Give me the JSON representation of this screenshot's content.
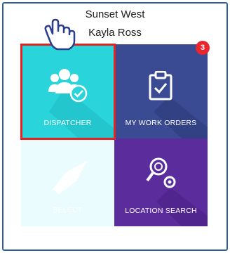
{
  "header": {
    "site_name": "Sunset West",
    "user_name": "Kayla Ross"
  },
  "tiles": [
    {
      "label": "DISPATCHER",
      "icon": "users-check-icon",
      "color": "#29d4db",
      "selected": true
    },
    {
      "label": "MY WORK ORDERS",
      "icon": "clipboard-check-icon",
      "color": "#3a4b94",
      "badge": "3"
    },
    {
      "label": "SELECT",
      "icon": "pointer-icon",
      "color": "#eafcfd",
      "disabled": true
    },
    {
      "label": "LOCATION SEARCH",
      "icon": "location-search-icon",
      "color": "#5a2c9c"
    }
  ],
  "colors": {
    "highlight": "#e32222",
    "badge": "#e8262c",
    "frame": "#2f5f9a"
  }
}
